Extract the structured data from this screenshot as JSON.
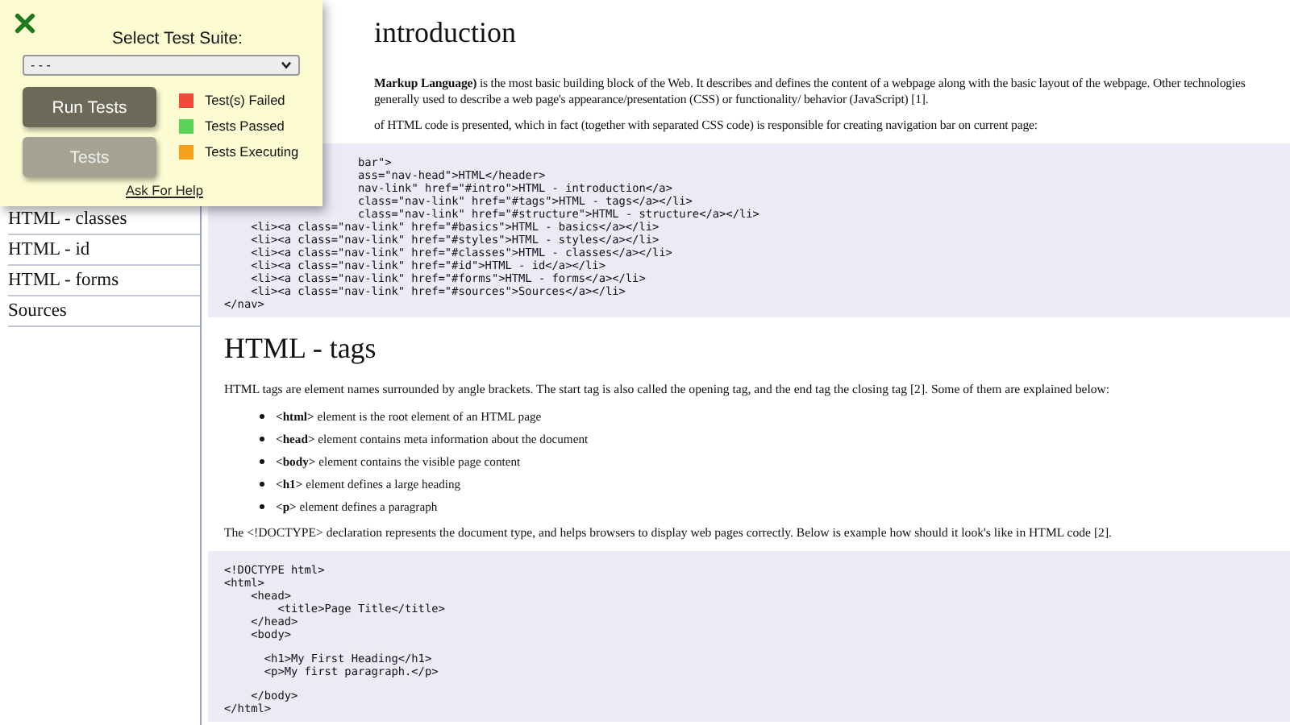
{
  "test_panel": {
    "title": "Select Test Suite:",
    "suite_select": {
      "value": "- - -"
    },
    "buttons": [
      {
        "label": "Run Tests",
        "kind": "primary"
      },
      {
        "label": "Tests",
        "kind": "secondary"
      }
    ],
    "legend": [
      {
        "label": "Test(s) Failed",
        "color": "#f04a3a"
      },
      {
        "label": "Tests Passed",
        "color": "#5ed35a"
      },
      {
        "label": "Tests Executing",
        "color": "#f5a01a"
      }
    ],
    "help_link": "Ask For Help"
  },
  "sidebar": {
    "items": [
      "HTML - classes",
      "HTML - id",
      "HTML - forms",
      "Sources"
    ]
  },
  "content": [
    {
      "kind": "heading",
      "text": "introduction"
    },
    {
      "kind": "paragraph",
      "lines": [
        "**Markup Language)** is the most basic building block of the Web. It describes and defines the content of a webpage along with the basic layout of the webpage. Other technologies",
        "generally used to describe a web page's appearance/presentation (CSS) or functionality/ behavior (JavaScript) [1]."
      ]
    },
    {
      "kind": "paragraph",
      "lines": [
        "of HTML code is presented, which in fact (together with separated CSS code) is responsible for creating navigation bar on current page:"
      ]
    },
    {
      "kind": "code",
      "lines_under_panel": [
        "bar\">",
        "ass=\"nav-head\">HTML</header>",
        "nav-link\" href=\"#intro\">HTML - introduction</a>",
        "class=\"nav-link\" href=\"#tags\">HTML - tags</a></li>",
        "class=\"nav-link\" href=\"#structure\">HTML - structure</a></li>"
      ],
      "lines": [
        "    <li><a class=\"nav-link\" href=\"#basics\">HTML - basics</a></li>",
        "    <li><a class=\"nav-link\" href=\"#styles\">HTML - styles</a></li>",
        "    <li><a class=\"nav-link\" href=\"#classes\">HTML - classes</a></li>",
        "    <li><a class=\"nav-link\" href=\"#id\">HTML - id</a></li>",
        "    <li><a class=\"nav-link\" href=\"#forms\">HTML - forms</a></li>",
        "    <li><a class=\"nav-link\" href=\"#sources\">Sources</a></li>",
        "</nav>"
      ]
    },
    {
      "kind": "heading",
      "text": "HTML - tags"
    },
    {
      "kind": "paragraph",
      "lines": [
        "HTML tags are element names surrounded by angle brackets. The start tag is also called the opening tag, and the end tag the closing tag [2]. Some of them are explained below:"
      ]
    },
    {
      "kind": "list",
      "items": [
        "**<html>** element is the root element of an HTML page",
        "**<head>** element contains meta information about the document",
        "**<body>** element contains the visible page content",
        "**<h1>** element defines a large heading",
        "**<p>** element defines a paragraph"
      ]
    },
    {
      "kind": "paragraph",
      "lines": [
        "The <!DOCTYPE> declaration represents the document type, and helps browsers to display web pages correctly. Below is example how should it look's like in HTML code [2]."
      ]
    },
    {
      "kind": "code",
      "line_groups": [
        [
          "<!DOCTYPE html>",
          "<html>",
          "    <head>",
          "        <title>Page Title</title>",
          "    </head>",
          "    <body>"
        ],
        [
          "      <h1>My First Heading</h1>",
          "      <p>My first paragraph.</p>"
        ],
        [
          "    </body>",
          "</html>"
        ]
      ]
    }
  ]
}
